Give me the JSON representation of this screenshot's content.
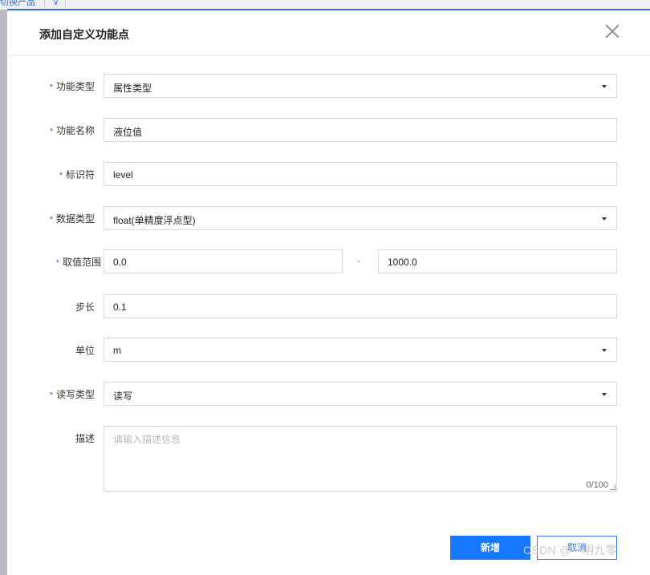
{
  "background": {
    "tab_label": "切换产品",
    "caret": "∨"
  },
  "dialog": {
    "title": "添加自定义功能点",
    "required_mark": "*",
    "fields": {
      "function_type": {
        "label": "功能类型",
        "value": "属性类型"
      },
      "function_name": {
        "label": "功能名称",
        "value": "液位值"
      },
      "identifier": {
        "label": "标识符",
        "value": "level"
      },
      "data_type": {
        "label": "数据类型",
        "value": "float(单精度浮点型)"
      },
      "value_range": {
        "label": "取值范围",
        "min": "0.0",
        "separator": "-",
        "max": "1000.0"
      },
      "step": {
        "label": "步长",
        "value": "0.1"
      },
      "unit": {
        "label": "单位",
        "value": "m"
      },
      "rw_type": {
        "label": "读写类型",
        "value": "读写"
      },
      "description": {
        "label": "描述",
        "placeholder": "请输入描述信息",
        "counter": "0/100"
      }
    },
    "buttons": {
      "submit": "新增",
      "cancel": "取消"
    }
  },
  "watermark": "CSDN @一明九零",
  "colors": {
    "accent": "#1677ff",
    "link": "#2f6fd6",
    "border": "#d5d8dd"
  },
  "icons": {
    "close": "close-icon",
    "dropdown": "caret-down-icon"
  }
}
